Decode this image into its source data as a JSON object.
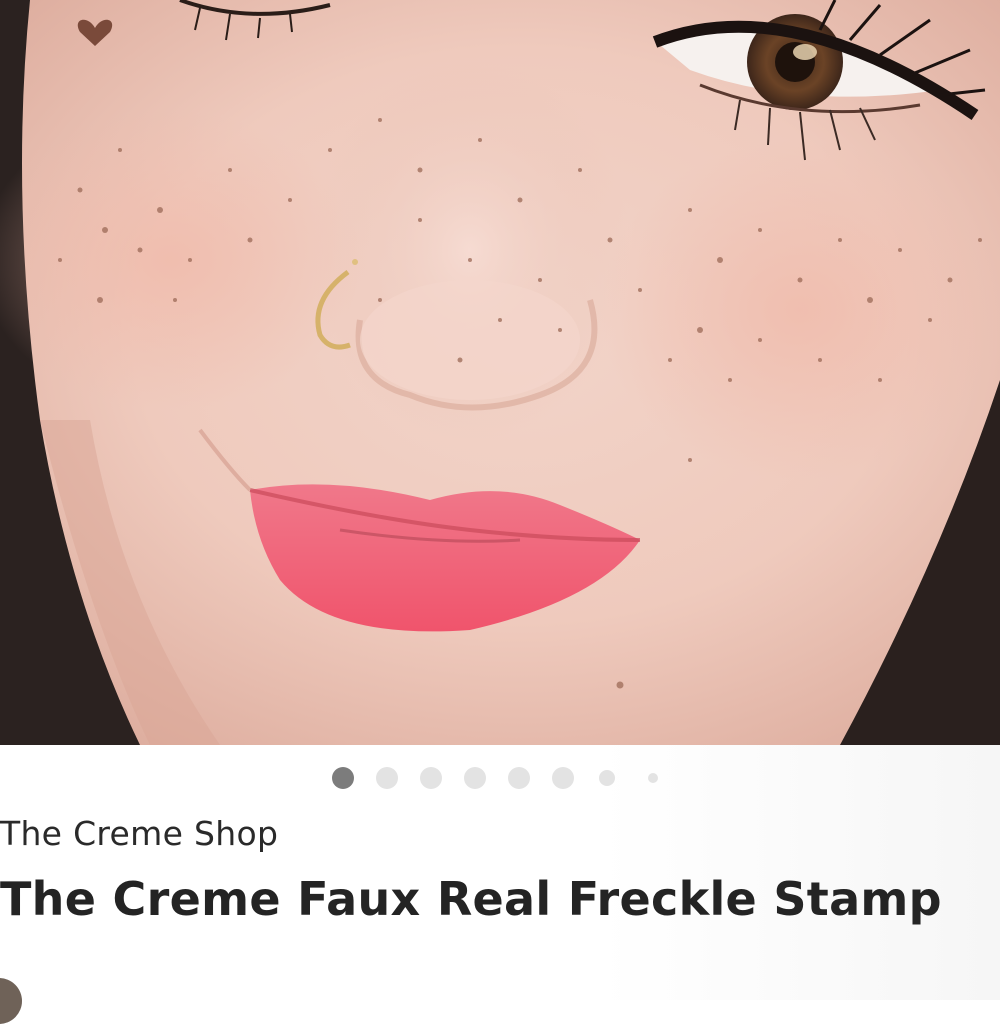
{
  "gallery": {
    "image_alt": "Close-up of a smiling face with freckles, a heart mark, a gold nose ring and pink lips",
    "total_images": 8,
    "active_index": 0
  },
  "product": {
    "brand": "The Creme Shop",
    "title": "The Creme Faux Real Freckle Stamp"
  },
  "colors": {
    "active_dot": "#7c7c7c",
    "inactive_dot": "#e3e3e3",
    "title_text": "#242424"
  }
}
